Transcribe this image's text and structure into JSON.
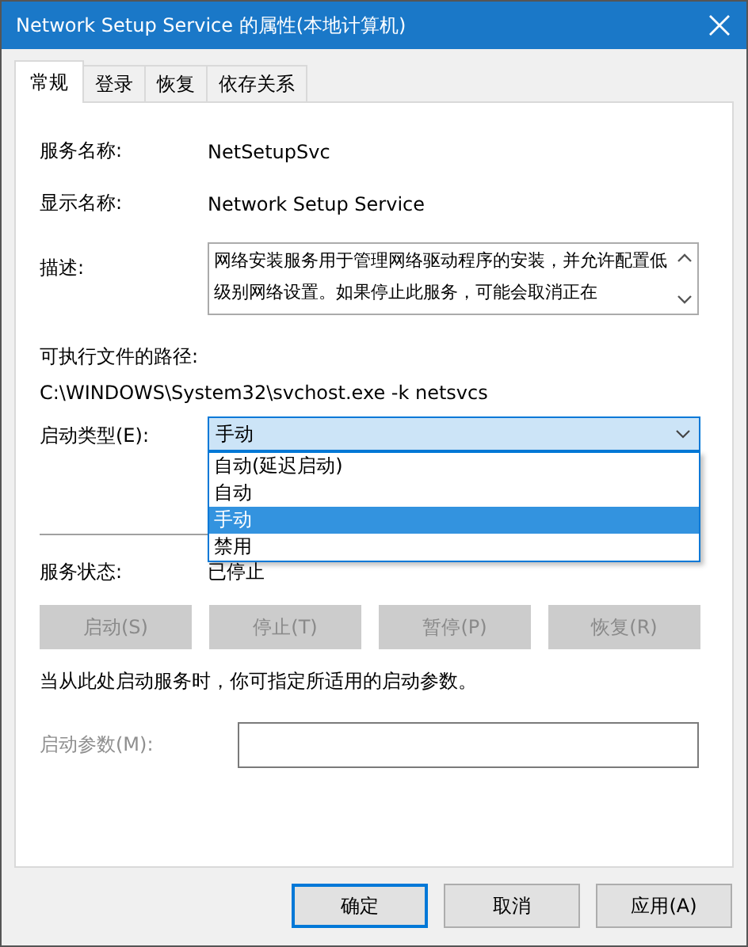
{
  "window": {
    "title": "Network Setup Service 的属性(本地计算机)"
  },
  "tabs": [
    {
      "label": "常规",
      "selected": true
    },
    {
      "label": "登录",
      "selected": false
    },
    {
      "label": "恢复",
      "selected": false
    },
    {
      "label": "依存关系",
      "selected": false
    }
  ],
  "fields": [
    {
      "label": "服务名称:",
      "value": "NetSetupSvc"
    },
    {
      "label": "显示名称:",
      "value": "Network Setup Service"
    }
  ],
  "description": {
    "label": "描述:",
    "value": "网络安装服务用于管理网络驱动程序的安装，并允许配置低级别网络设置。如果停止此服务，可能会取消正在"
  },
  "path": {
    "label": "可执行文件的路径:",
    "value": "C:\\WINDOWS\\System32\\svchost.exe -k netsvcs"
  },
  "startup_type": {
    "label": "启动类型(E):",
    "value": "手动",
    "expanded": true,
    "options": [
      {
        "label": "自动(延迟启动)",
        "selected": false
      },
      {
        "label": "自动",
        "selected": false
      },
      {
        "label": "手动",
        "selected": true
      },
      {
        "label": "禁用",
        "selected": false
      }
    ]
  },
  "status": {
    "label": "服务状态:",
    "value": "已停止"
  },
  "service_buttons": [
    {
      "label": "启动(S)",
      "disabled": true
    },
    {
      "label": "停止(T)",
      "disabled": true
    },
    {
      "label": "暂停(P)",
      "disabled": true
    },
    {
      "label": "恢复(R)",
      "disabled": true
    }
  ],
  "hint": "当从此处启动服务时，你可指定所适用的启动参数。",
  "parameters": {
    "label": "启动参数(M):",
    "disabled": true
  },
  "dialog_buttons": [
    {
      "label": "确定",
      "default": true
    },
    {
      "label": "取消",
      "default": false
    },
    {
      "label": "应用(A)",
      "default": false
    }
  ]
}
